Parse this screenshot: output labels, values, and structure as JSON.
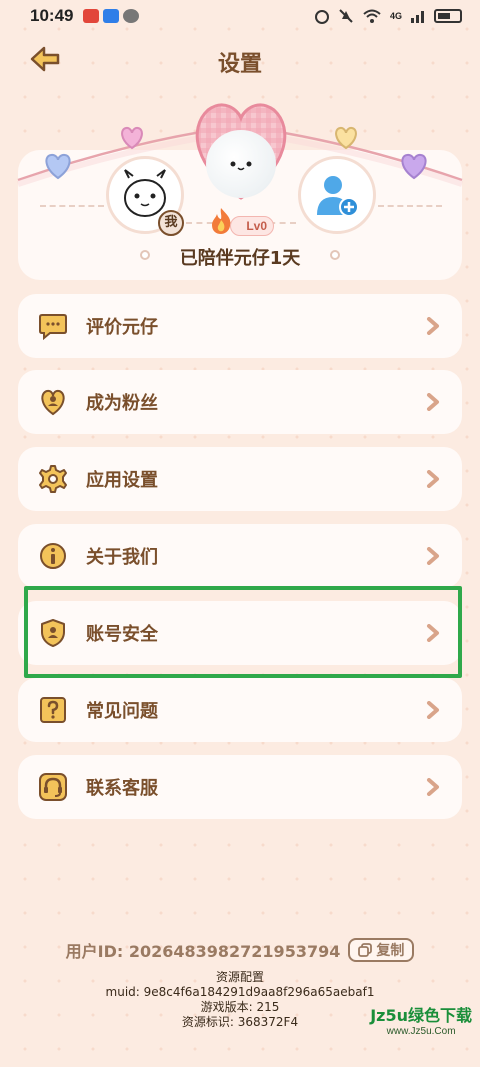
{
  "status_bar": {
    "time": "10:49",
    "signal": "4G",
    "battery": "battery-icon"
  },
  "header": {
    "title": "设置"
  },
  "profile": {
    "me_tag": "我",
    "level": "Lv0",
    "together_text": "已陪伴元仔1天"
  },
  "menu": {
    "items": [
      {
        "label": "评价元仔",
        "icon": "chat-bubble-icon"
      },
      {
        "label": "成为粉丝",
        "icon": "heart-user-icon"
      },
      {
        "label": "应用设置",
        "icon": "gear-icon"
      },
      {
        "label": "关于我们",
        "icon": "info-icon"
      },
      {
        "label": "账号安全",
        "icon": "shield-user-icon"
      },
      {
        "label": "常见问题",
        "icon": "question-icon"
      },
      {
        "label": "联系客服",
        "icon": "headset-icon"
      }
    ]
  },
  "footer": {
    "user_id": "用户ID: 2026483982721953794",
    "copy_label": "复制",
    "resource_config": "资源配置",
    "muid": "muid: 9e8c4f6a184291d9aa8f296a65aebaf1",
    "game_version": "游戏版本: 215",
    "resource_id": "资源标识: 368372F4"
  },
  "watermark": {
    "main": "Jz5u绿色下载",
    "sub": "www.Jz5u.Com"
  },
  "colors": {
    "background": "#fcebe1",
    "text_brown": "#7a4f2c",
    "icon_gold": "#f3c35a",
    "highlight_green": "#2fa84a"
  }
}
